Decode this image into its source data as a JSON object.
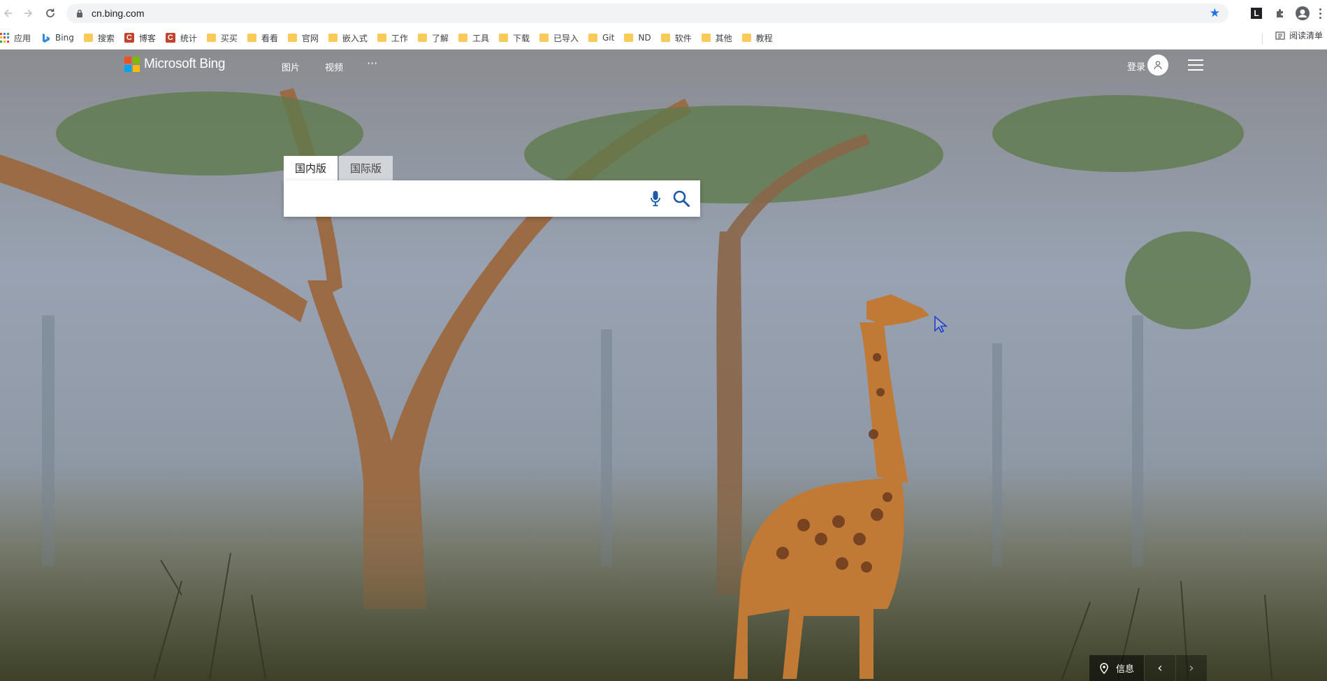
{
  "browser": {
    "url": "cn.bing.com",
    "bookmarks": [
      {
        "label": "应用",
        "icon": "apps-grid-icon"
      },
      {
        "label": "Bing",
        "icon": "bing-icon"
      },
      {
        "label": "搜索",
        "icon": "folder-icon"
      },
      {
        "label": "博客",
        "icon": "c-site-icon"
      },
      {
        "label": "统计",
        "icon": "c-site-icon"
      },
      {
        "label": "买买",
        "icon": "folder-icon"
      },
      {
        "label": "看看",
        "icon": "folder-icon"
      },
      {
        "label": "官网",
        "icon": "folder-icon"
      },
      {
        "label": "嵌入式",
        "icon": "folder-icon"
      },
      {
        "label": "工作",
        "icon": "folder-icon"
      },
      {
        "label": "了解",
        "icon": "folder-icon"
      },
      {
        "label": "工具",
        "icon": "folder-icon"
      },
      {
        "label": "下载",
        "icon": "folder-icon"
      },
      {
        "label": "已导入",
        "icon": "folder-icon"
      },
      {
        "label": "Git",
        "icon": "folder-icon"
      },
      {
        "label": "ND",
        "icon": "folder-icon"
      },
      {
        "label": "软件",
        "icon": "folder-icon"
      },
      {
        "label": "其他",
        "icon": "folder-icon"
      },
      {
        "label": "教程",
        "icon": "folder-icon"
      }
    ],
    "reading_list": "阅读清单",
    "extension_letter": "L"
  },
  "bing": {
    "logo_text": "Microsoft Bing",
    "nav": {
      "images": "图片",
      "videos": "视频",
      "more": "···"
    },
    "login": "登录",
    "tabs": {
      "domestic": "国内版",
      "international": "国际版"
    },
    "search_value": "",
    "info_label": "信息",
    "prev_arrow": "‹",
    "next_arrow": "›"
  },
  "colors": {
    "star": "#1a73e8",
    "folder": "#f9ca58",
    "c_icon": "#c4432c",
    "logo_red": "#f25022",
    "logo_green": "#7fba00",
    "logo_blue": "#00a4ef",
    "logo_yellow": "#ffb900"
  }
}
